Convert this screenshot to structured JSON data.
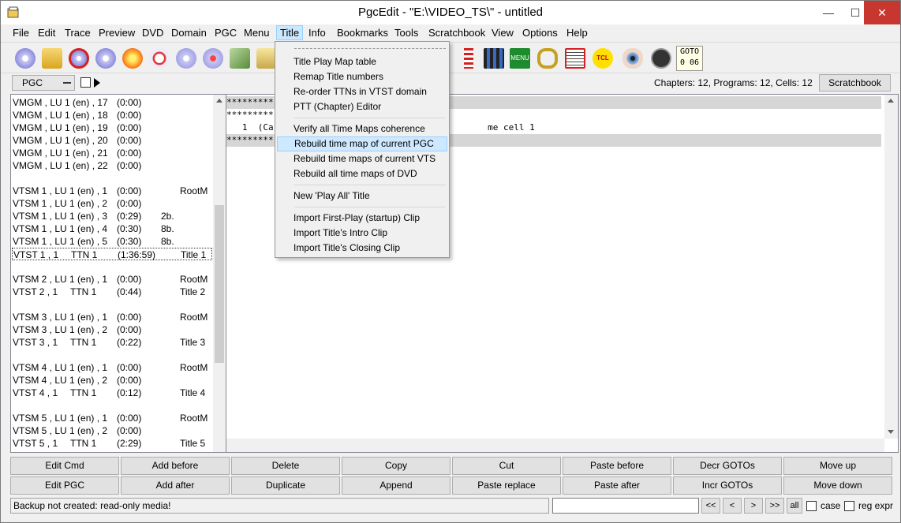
{
  "window": {
    "title": "PgcEdit -   \"E:\\VIDEO_TS\\\" - untitled",
    "minimize": "—",
    "maximize": "☐",
    "close": "✕"
  },
  "menubar": [
    "File",
    "Edit",
    "Trace",
    "Preview",
    "DVD",
    "Domain",
    "PGC",
    "Menu",
    "Title",
    "Info",
    "Bookmarks",
    "Tools",
    "Scratchbook",
    "View",
    "Options",
    "Help"
  ],
  "menubar_active": "Title",
  "toolbar": {
    "icons": [
      "dvd-icon",
      "open-folder-icon",
      "back-icon",
      "dvd-new-icon",
      "burn-icon",
      "search-dvd-icon",
      "multi-disc-icon",
      "arrow-dvd-icon",
      "disc-stack-icon",
      "folder-dvd-icon",
      "checklist-icon",
      "film-strip-icon",
      "menu-icon",
      "chain-link-icon",
      "hex-search-icon",
      "tcl-icon",
      "eye-icon",
      "navigation-icon"
    ],
    "menu_icon_label": "MENU",
    "tcl_icon_label": "TCL",
    "goto_label": "GOTO",
    "goto_value": "0  06"
  },
  "row2": {
    "pgc_select": "PGC",
    "counts": "Chapters: 12,  Programs: 12,  Cells: 12",
    "scratchbook_button": "Scratchbook"
  },
  "left_list": [
    {
      "c1": "VMGM , LU 1 (en) , 17",
      "c2": "",
      "c3": "(0:00)",
      "c4": "",
      "c5": ""
    },
    {
      "c1": "VMGM , LU 1 (en) , 18",
      "c2": "",
      "c3": "(0:00)",
      "c4": "",
      "c5": ""
    },
    {
      "c1": "VMGM , LU 1 (en) , 19",
      "c2": "",
      "c3": "(0:00)",
      "c4": "",
      "c5": ""
    },
    {
      "c1": "VMGM , LU 1 (en) , 20",
      "c2": "",
      "c3": "(0:00)",
      "c4": "",
      "c5": ""
    },
    {
      "c1": "VMGM , LU 1 (en) , 21",
      "c2": "",
      "c3": "(0:00)",
      "c4": "",
      "c5": ""
    },
    {
      "c1": "VMGM , LU 1 (en) , 22",
      "c2": "",
      "c3": "(0:00)",
      "c4": "",
      "c5": ""
    },
    {
      "c1": "",
      "c2": "",
      "c3": "",
      "c4": "",
      "c5": ""
    },
    {
      "c1": "VTSM 1 , LU 1 (en) , 1",
      "c2": "",
      "c3": "(0:00)",
      "c4": "",
      "c5": "RootM"
    },
    {
      "c1": "VTSM 1 , LU 1 (en) , 2",
      "c2": "",
      "c3": "(0:00)",
      "c4": "",
      "c5": ""
    },
    {
      "c1": "VTSM 1 , LU 1 (en) , 3",
      "c2": "",
      "c3": "(0:29)",
      "c4": "2b.",
      "c5": ""
    },
    {
      "c1": "VTSM 1 , LU 1 (en) , 4",
      "c2": "",
      "c3": "(0:30)",
      "c4": "8b.",
      "c5": ""
    },
    {
      "c1": "VTSM 1 , LU 1 (en) , 5",
      "c2": "",
      "c3": "(0:30)",
      "c4": "8b.",
      "c5": ""
    },
    {
      "c1": "VTST 1 , 1",
      "c2": "TTN 1",
      "c3": "(1:36:59)",
      "c4": "",
      "c5": "Title 1",
      "selected": true
    },
    {
      "c1": "",
      "c2": "",
      "c3": "",
      "c4": "",
      "c5": ""
    },
    {
      "c1": "VTSM 2 , LU 1 (en) , 1",
      "c2": "",
      "c3": "(0:00)",
      "c4": "",
      "c5": "RootM"
    },
    {
      "c1": "VTST 2 , 1",
      "c2": "TTN 1",
      "c3": "(0:44)",
      "c4": "",
      "c5": "Title 2"
    },
    {
      "c1": "",
      "c2": "",
      "c3": "",
      "c4": "",
      "c5": ""
    },
    {
      "c1": "VTSM 3 , LU 1 (en) , 1",
      "c2": "",
      "c3": "(0:00)",
      "c4": "",
      "c5": "RootM"
    },
    {
      "c1": "VTSM 3 , LU 1 (en) , 2",
      "c2": "",
      "c3": "(0:00)",
      "c4": "",
      "c5": ""
    },
    {
      "c1": "VTST 3 , 1",
      "c2": "TTN 1",
      "c3": "(0:22)",
      "c4": "",
      "c5": "Title 3"
    },
    {
      "c1": "",
      "c2": "",
      "c3": "",
      "c4": "",
      "c5": ""
    },
    {
      "c1": "VTSM 4 , LU 1 (en) , 1",
      "c2": "",
      "c3": "(0:00)",
      "c4": "",
      "c5": "RootM"
    },
    {
      "c1": "VTSM 4 , LU 1 (en) , 2",
      "c2": "",
      "c3": "(0:00)",
      "c4": "",
      "c5": ""
    },
    {
      "c1": "VTST 4 , 1",
      "c2": "TTN 1",
      "c3": "(0:12)",
      "c4": "",
      "c5": "Title 4"
    },
    {
      "c1": "",
      "c2": "",
      "c3": "",
      "c4": "",
      "c5": ""
    },
    {
      "c1": "VTSM 5 , LU 1 (en) , 1",
      "c2": "",
      "c3": "(0:00)",
      "c4": "",
      "c5": "RootM"
    },
    {
      "c1": "VTSM 5 , LU 1 (en) , 2",
      "c2": "",
      "c3": "(0:00)",
      "c4": "",
      "c5": ""
    },
    {
      "c1": "VTST 5 , 1",
      "c2": "TTN 1",
      "c3": "(2:29)",
      "c4": "",
      "c5": "Title 5"
    }
  ],
  "code_lines": [
    "*********",
    "*********",
    "   1  (Ca                                         me cell 1",
    "*********"
  ],
  "title_menu": {
    "items": [
      "Title Play Map table",
      "Remap Title numbers",
      "Re-order TTNs in VTST domain",
      "PTT (Chapter) Editor",
      "Verify all Time Maps coherence",
      "Rebuild time map of current PGC",
      "Rebuild time maps of current VTS",
      "Rebuild all time maps of DVD",
      "New 'Play All' Title",
      "Import First-Play (startup) Clip",
      "Import Title's Intro Clip",
      "Import Title's Closing Clip"
    ],
    "highlighted": "Rebuild time map of current PGC"
  },
  "buttons_row1": [
    "Edit Cmd",
    "Add before",
    "Delete",
    "Copy",
    "Cut",
    "Paste before",
    "Decr GOTOs",
    "Move up"
  ],
  "buttons_row2": [
    "Edit PGC",
    "Add after",
    "Duplicate",
    "Append",
    "Paste replace",
    "Paste after",
    "Incr GOTOs",
    "Move down"
  ],
  "statusbar": {
    "message": "Backup not created: read-only media!",
    "search_value": "",
    "nav": [
      "<<",
      "<",
      ">",
      ">>",
      "all"
    ],
    "case_label": "case",
    "regexpr_label": "reg expr"
  },
  "colors": {
    "menu_highlight": "#cde8ff",
    "close_button": "#c7372f",
    "code_header": "#d6d6d6"
  }
}
